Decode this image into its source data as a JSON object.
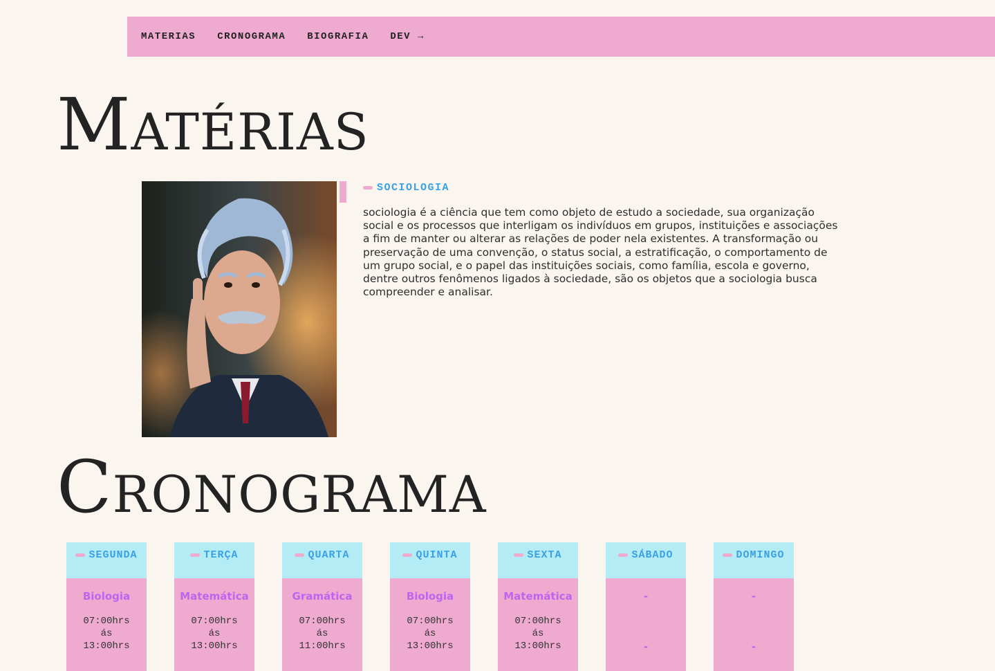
{
  "nav": {
    "items": [
      {
        "label": "MATERIAS"
      },
      {
        "label": "CRONOGRAMA"
      },
      {
        "label": "BIOGRAFIA"
      },
      {
        "label": "DEV →"
      }
    ]
  },
  "materias": {
    "title": "Matérias",
    "subject": {
      "label": "SOCIOLOGIA",
      "text": "sociologia é a ciência que tem como objeto de estudo a sociedade, sua organização social e os processos que interligam os indivíduos em grupos, instituições e associações a fim de manter ou alterar as relações de poder nela existentes. A transformação ou preservação de uma convenção, o status social, a estratificação, o comportamento de um grupo social, e o papel das instituições sociais, como família, escola e governo, dentre outros fenômenos ligados à sociedade, são os objetos que a sociologia busca compreender e analisar."
    }
  },
  "cronograma": {
    "title": "Cronograma",
    "days": [
      {
        "day": "SEGUNDA",
        "subject": "Biologia",
        "time": "07:00hrs\nás\n13:00hrs"
      },
      {
        "day": "TERÇA",
        "subject": "Matemática",
        "time": "07:00hrs\nás\n13:00hrs"
      },
      {
        "day": "QUARTA",
        "subject": "Gramática",
        "time": "07:00hrs\nás\n11:00hrs"
      },
      {
        "day": "QUINTA",
        "subject": "Biologia",
        "time": "07:00hrs\nás\n13:00hrs"
      },
      {
        "day": "SEXTA",
        "subject": "Matemática",
        "time": "07:00hrs\nás\n13:00hrs"
      },
      {
        "day": "SÁBADO",
        "subject": "-",
        "time_placeholder": "-"
      },
      {
        "day": "DOMINGO",
        "subject": "-",
        "time_placeholder": "-"
      }
    ]
  }
}
